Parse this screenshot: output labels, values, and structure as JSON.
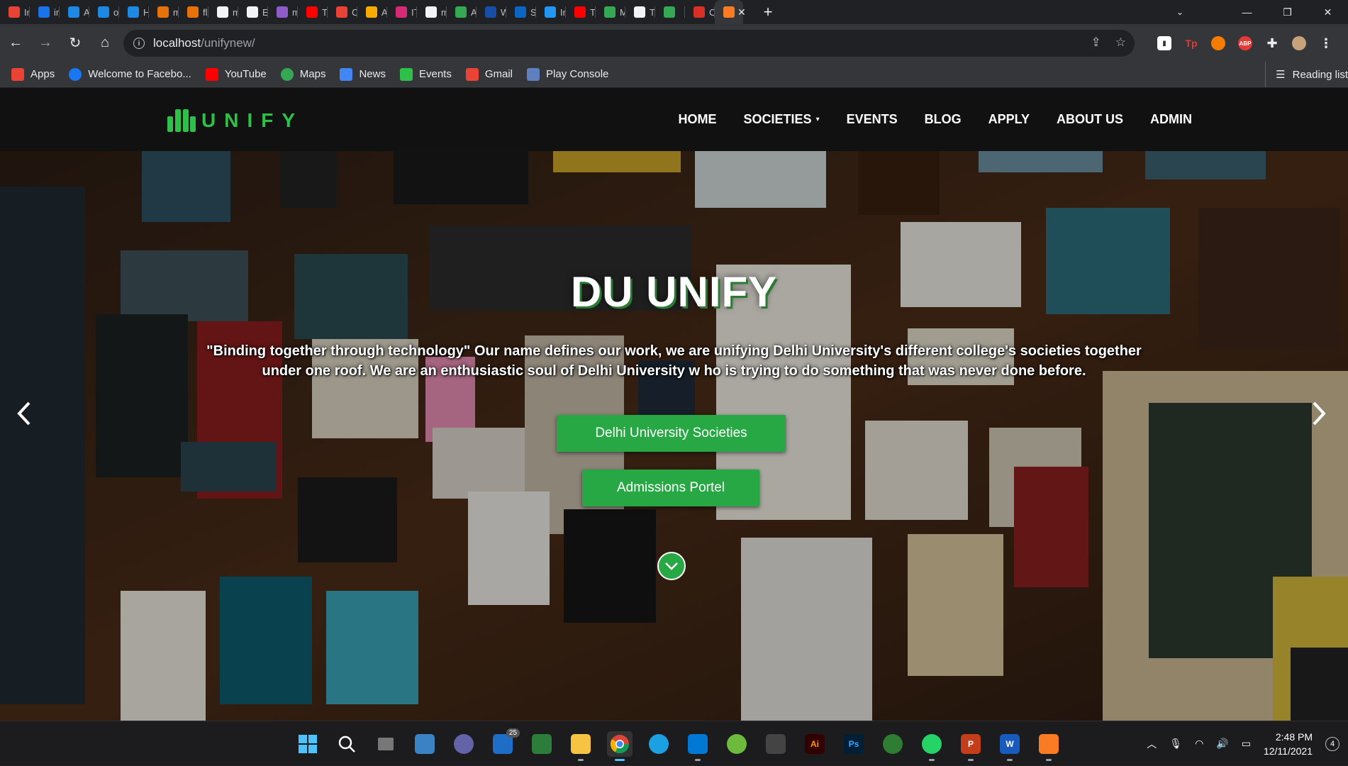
{
  "browser": {
    "tabs": [
      {
        "label": "In",
        "color": "#ea4335"
      },
      {
        "label": "in",
        "color": "#1a73e8"
      },
      {
        "label": "AI",
        "color": "#1e88e5"
      },
      {
        "label": "or",
        "color": "#1e88e5"
      },
      {
        "label": "H",
        "color": "#1e88e5"
      },
      {
        "label": "m",
        "color": "#e8710a"
      },
      {
        "label": "flu",
        "color": "#e8710a"
      },
      {
        "label": "m",
        "color": "#f1f3f4"
      },
      {
        "label": "Ec",
        "color": "#f1f3f4"
      },
      {
        "label": "m",
        "color": "#8e5bc9"
      },
      {
        "label": "Tl",
        "color": "#ff0000"
      },
      {
        "label": "Cc",
        "color": "#ea4335"
      },
      {
        "label": "A:",
        "color": "#f9ab00"
      },
      {
        "label": "IT",
        "color": "#d62976"
      },
      {
        "label": "m",
        "color": "#f1f3f4"
      },
      {
        "label": "A:",
        "color": "#34a853"
      },
      {
        "label": "W",
        "color": "#174ea6"
      },
      {
        "label": "Si",
        "color": "#0a66c2"
      },
      {
        "label": "In",
        "color": "#2196f3"
      },
      {
        "label": "Tl",
        "color": "#ff0000"
      },
      {
        "label": "M",
        "color": "#34a853"
      },
      {
        "label": "Tr",
        "color": "#f1f3f4"
      },
      {
        "label": "",
        "color": "#34a853"
      },
      {
        "label": "Cl",
        "color": "#d93025"
      }
    ],
    "active_tab_icon_color": "#fb7a24",
    "address": {
      "host": "localhost",
      "path": "/unifynew/"
    },
    "bookmarks": [
      {
        "label": "Apps",
        "color": "#ea4335"
      },
      {
        "label": "Welcome to Facebo...",
        "color": "#1877f2"
      },
      {
        "label": "YouTube",
        "color": "#ff0000"
      },
      {
        "label": "Maps",
        "color": "#34a853"
      },
      {
        "label": "News",
        "color": "#4285f4"
      },
      {
        "label": "Events",
        "color": "#2ec14a"
      },
      {
        "label": "Gmail",
        "color": "#ea4335"
      },
      {
        "label": "Play Console",
        "color": "#5f7fbf"
      }
    ],
    "reading_list": "Reading list",
    "extensions": [
      "Tp",
      "ABP"
    ]
  },
  "site": {
    "logo_text": "UNIFY",
    "nav": [
      "HOME",
      "SOCIETIES",
      "EVENTS",
      "BLOG",
      "APPLY",
      "ABOUT US",
      "ADMIN"
    ],
    "societies_caret": "▾",
    "hero": {
      "title": "DU UNIFY",
      "text": "\"Binding together through technology\" Our name defines our work, we are unifying Delhi University's different college's societies together under one roof. We are an enthusiastic soul of Delhi University w ho is trying to do something that was never done before.",
      "button_primary": "Delhi University Societies",
      "button_secondary": "Admissions Portel"
    },
    "accent": "#28a745"
  },
  "taskbar": {
    "mail_badge": "25",
    "time": "2:48 PM",
    "date": "12/11/2021",
    "notifications": "4"
  }
}
